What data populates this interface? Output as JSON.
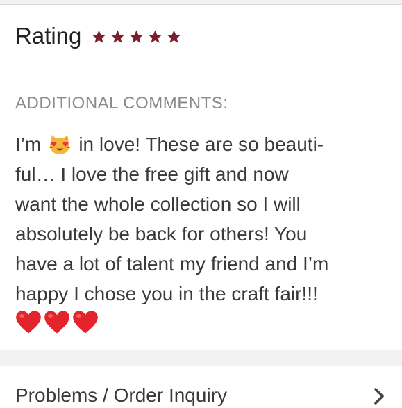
{
  "review": {
    "rating_label": "Rating",
    "rating_value": 5,
    "rating_max": 5,
    "star_color": "#7a1f2b",
    "additional_comments_label": "ADDITIONAL COMMENTS:",
    "comment_lines": {
      "line1_before_emoji": "I’m",
      "line1_after_emoji": "in love! These are so beauti-",
      "line2": "ful… I love the free gift and now",
      "line3": "want the whole collection so I will",
      "line4": "absolutely be back for others! You",
      "line5": "have a lot of talent my friend and I’m",
      "line6": "happy I chose you in the craft fair!!!"
    },
    "inline_emoji": "smiling-cat-heart-eyes-emoji",
    "trailing_emojis": [
      "red-heart-emoji",
      "red-heart-emoji",
      "red-heart-emoji"
    ],
    "heart_color": "#e3242b"
  },
  "inquiry": {
    "label": "Problems / Order Inquiry",
    "icon": "chevron-right-icon"
  }
}
